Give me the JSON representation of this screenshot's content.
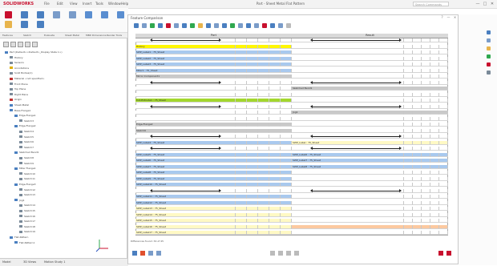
{
  "app": {
    "logo_text": "SOLIDWORKS",
    "doc_title": "Part - Sheet Metal Flat Pattern",
    "search_placeholder": "Search Commands"
  },
  "menus": [
    "File",
    "Edit",
    "View",
    "Insert",
    "Tools",
    "Window",
    "Help"
  ],
  "window_buttons": [
    "—",
    "□",
    "✕"
  ],
  "cmd_tabs": [
    "Features",
    "Sketch",
    "Evaluate",
    "Sheet Metal",
    "MBD Dimensions",
    "Render Tools"
  ],
  "bottom_tabs": [
    "Model",
    "3D Views",
    "Motion Study 1"
  ],
  "tree": [
    {
      "label": "Part (Default<<Default>_Display State 1>)",
      "indent": 0,
      "icon": "#4a7fc0"
    },
    {
      "label": "History",
      "indent": 1,
      "icon": "#7a8a99"
    },
    {
      "label": "Sensors",
      "indent": 1,
      "icon": "#7a8a99"
    },
    {
      "label": "Annotations",
      "indent": 1,
      "icon": "#e0b000"
    },
    {
      "label": "Solid Bodies(1)",
      "indent": 1,
      "icon": "#7a8a99"
    },
    {
      "label": "Material <not specified>",
      "indent": 1,
      "icon": "#c03030"
    },
    {
      "label": "Front Plane",
      "indent": 1,
      "icon": "#7a8a99"
    },
    {
      "label": "Top Plane",
      "indent": 1,
      "icon": "#7a8a99"
    },
    {
      "label": "Right Plane",
      "indent": 1,
      "icon": "#7a8a99"
    },
    {
      "label": "Origin",
      "indent": 1,
      "icon": "#c03030"
    },
    {
      "label": "Sheet-Metal",
      "indent": 1,
      "icon": "#4a7fc0"
    },
    {
      "label": "Base-Flange1",
      "indent": 1,
      "icon": "#4a7fc0"
    },
    {
      "label": "Edge-Flange1",
      "indent": 2,
      "icon": "#4a7fc0"
    },
    {
      "label": "Sketch3",
      "indent": 3,
      "icon": "#7a8a99"
    },
    {
      "label": "Edge-Flange2",
      "indent": 2,
      "icon": "#4a7fc0"
    },
    {
      "label": "Sketch4",
      "indent": 3,
      "icon": "#7a8a99"
    },
    {
      "label": "Sketch5",
      "indent": 3,
      "icon": "#7a8a99"
    },
    {
      "label": "Sketch6",
      "indent": 3,
      "icon": "#7a8a99"
    },
    {
      "label": "Sketch7",
      "indent": 3,
      "icon": "#7a8a99"
    },
    {
      "label": "Sketched Bend1",
      "indent": 2,
      "icon": "#4a7fc0"
    },
    {
      "label": "Sketch8",
      "indent": 3,
      "icon": "#7a8a99"
    },
    {
      "label": "Sketch9",
      "indent": 3,
      "icon": "#7a8a99"
    },
    {
      "label": "Miter Flange1",
      "indent": 2,
      "icon": "#4a7fc0"
    },
    {
      "label": "Sketch10",
      "indent": 3,
      "icon": "#7a8a99"
    },
    {
      "label": "Sketch11",
      "indent": 3,
      "icon": "#7a8a99"
    },
    {
      "label": "Edge-Flange3",
      "indent": 2,
      "icon": "#4a7fc0"
    },
    {
      "label": "Sketch12",
      "indent": 3,
      "icon": "#7a8a99"
    },
    {
      "label": "Sketch13",
      "indent": 3,
      "icon": "#7a8a99"
    },
    {
      "label": "Jog1",
      "indent": 2,
      "icon": "#4a7fc0"
    },
    {
      "label": "Sketch14",
      "indent": 3,
      "icon": "#7a8a99"
    },
    {
      "label": "Sketch15",
      "indent": 3,
      "icon": "#7a8a99"
    },
    {
      "label": "Sketch16",
      "indent": 3,
      "icon": "#7a8a99"
    },
    {
      "label": "Sketch17",
      "indent": 3,
      "icon": "#7a8a99"
    },
    {
      "label": "Sketch18",
      "indent": 3,
      "icon": "#7a8a99"
    },
    {
      "label": "Sketch19",
      "indent": 3,
      "icon": "#7a8a99"
    },
    {
      "label": "Flat-Pattern",
      "indent": 1,
      "icon": "#4a7fc0"
    },
    {
      "label": "Flat-Pattern1",
      "indent": 2,
      "icon": "#4a7fc0"
    }
  ],
  "dialog": {
    "title": "Feature Comparison",
    "buttons": [
      "?",
      "—",
      "✕"
    ],
    "status": "Differences found: 34 of 45"
  },
  "grid": {
    "headers": [
      {
        "text": "Part"
      },
      {
        "text": "Result"
      }
    ],
    "left_cols": 5,
    "right_cols": 5,
    "rows": [
      {
        "l": "",
        "lc": "#ffffff",
        "r": "",
        "rc": "#ffffff",
        "la": true,
        "ra": true
      },
      {
        "l": "History",
        "lc": "#fff700",
        "r": "",
        "rc": "#ffffff"
      },
      {
        "l": "SWP_Label1 : 75_Sheet",
        "lc": "#a9c9ee",
        "r": "",
        "rc": "#ffffff"
      },
      {
        "l": "SWP_Label2 : 75_Sheet",
        "lc": "#a9c9ee",
        "r": "",
        "rc": "#ffffff"
      },
      {
        "l": "SWP_Label3 : 75_Sheet",
        "lc": "#a9c9ee",
        "r": "",
        "rc": "#ffffff"
      },
      {
        "l": "Miter1 : 75_Sheet",
        "lc": "#a9c9ee",
        "r": "",
        "rc": "#ffffff"
      },
      {
        "l": "Mirror Component1",
        "lc": "#c9c9c9",
        "r": "",
        "rc": "#ffffff"
      },
      {
        "l": "",
        "lc": "#ffffff",
        "r": "",
        "rc": "#ffffff",
        "la": true,
        "ra": true
      },
      {
        "l": "",
        "lc": "#ffffff",
        "r": "Sketched Bend1",
        "rc": "#c9c9c9"
      },
      {
        "l": "",
        "lc": "#ffffff",
        "r": "",
        "rc": "#ffffff"
      },
      {
        "l": "Cut-Extrude1 : 75_Sheet",
        "lc": "#a3d72d",
        "r": "",
        "rc": "#ffffff"
      },
      {
        "l": "",
        "lc": "#ffffff",
        "r": "",
        "rc": "#ffffff",
        "la": true,
        "ra": true
      },
      {
        "l": "",
        "lc": "#ffffff",
        "r": "Jog1",
        "rc": "#c9c9c9"
      },
      {
        "l": "",
        "lc": "#ffffff",
        "r": "",
        "rc": "#ffffff"
      },
      {
        "l": "Edge-Flange2",
        "lc": "#c9c9c9",
        "r": "",
        "rc": "#ffffff"
      },
      {
        "l": "Sketch6",
        "lc": "#c9c9c9",
        "r": "",
        "rc": "#ffffff"
      },
      {
        "l": "",
        "lc": "#ffffff",
        "r": "",
        "rc": "#ffffff",
        "la": true,
        "ra": true
      },
      {
        "l": "SWP_Label4 : 75_Sheet",
        "lc": "#a9c9ee",
        "r": "SWP_Label : 75_Sheet",
        "rc": "#fff9c4"
      },
      {
        "l": "",
        "lc": "#ffffff",
        "r": "",
        "rc": "#ffffff",
        "la": true,
        "ra": true
      },
      {
        "l": "SWP_Label5 : 75_Sheet",
        "lc": "#a9c9ee",
        "r": "SWP_Label6 : 75_Sheet",
        "rc": "#a9c9ee"
      },
      {
        "l": "SWP_Label6 : 75_Sheet",
        "lc": "#a9c9ee",
        "r": "SWP_Label7 : 75_Sheet",
        "rc": "#a9c9ee"
      },
      {
        "l": "SWP_Label7 : 75_Sheet",
        "lc": "#a9c9ee",
        "r": "SWP_Label8 : 75_Sheet",
        "rc": "#a9c9ee"
      },
      {
        "l": "SWP_Label8 : 75_Sheet",
        "lc": "#a9c9ee",
        "r": "",
        "rc": "#ffffff"
      },
      {
        "l": "SWP_Label9 : 75_Sheet",
        "lc": "#a9c9ee",
        "r": "",
        "rc": "#ffffff"
      },
      {
        "l": "SWP_Label10 : 75_Sheet",
        "lc": "#a9c9ee",
        "r": "",
        "rc": "#ffffff"
      },
      {
        "l": "",
        "lc": "#ffffff",
        "r": "",
        "rc": "#ffffff",
        "la": true,
        "ra": true
      },
      {
        "l": "SWP_Label11 : 75_Sheet",
        "lc": "#a9c9ee",
        "r": "",
        "rc": "#ffffff"
      },
      {
        "l": "SWP_Label12 : 75_Sheet",
        "lc": "#a9c9ee",
        "r": "",
        "rc": "#ffffff"
      },
      {
        "l": "SWP_Label13 : 75_Sheet",
        "lc": "#fff9c4",
        "r": "",
        "rc": "#ffffff"
      },
      {
        "l": "SWP_Label14 : 75_Sheet",
        "lc": "#fff9c4",
        "r": "",
        "rc": "#ffffff"
      },
      {
        "l": "SWP_Label15 : 75_Sheet",
        "lc": "#fff9c4",
        "r": "",
        "rc": "#ffffff"
      },
      {
        "l": "SWP_Label16 : 75_Sheet",
        "lc": "#fff9c4",
        "r": "",
        "rc": "#fcc9a0"
      },
      {
        "l": "SWP_Label17 : 75_Sheet",
        "lc": "#fff9c4",
        "r": "",
        "rc": "#ffffff"
      }
    ]
  }
}
